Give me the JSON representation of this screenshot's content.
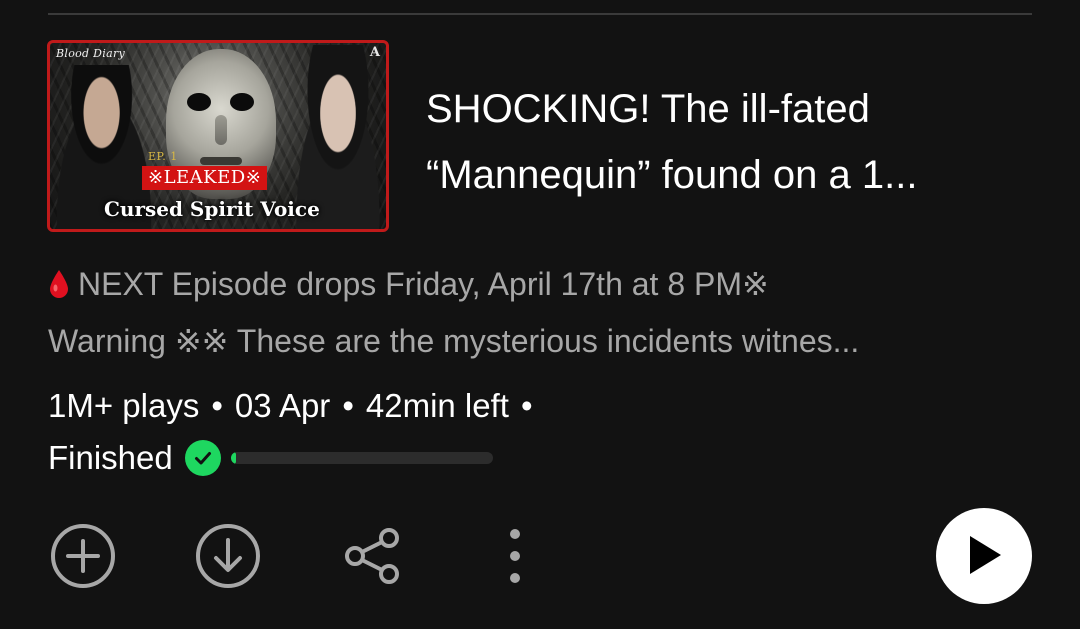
{
  "episode": {
    "thumbnail": {
      "logo_text": "Blood Diary",
      "corner_mark": "A",
      "episode_label": "EP. 1",
      "leaked_label": "※LEAKED※",
      "subtitle": "Cursed Spirit Voice"
    },
    "title_line1": "SHOCKING! The ill-fated",
    "title_line2": "“Mannequin” found on a 1...",
    "description_line1": "NEXT Episode drops Friday, April 17th at 8 PM※",
    "description_line2": "Warning ※※ These are the mysterious incidents witnes...",
    "description_icon": "blood-drop-icon",
    "plays": "1M+ plays",
    "date": "03 Apr",
    "time_left": "42min left",
    "separator": "•",
    "status": "Finished",
    "progress_fraction": 0.02
  },
  "actions": {
    "add": "add-circle-icon",
    "download": "download-circle-icon",
    "share": "share-icon",
    "more": "more-vertical-icon",
    "play": "play-icon"
  },
  "colors": {
    "background": "#121212",
    "accent_green": "#1ed760",
    "secondary_text": "#a7a7a7",
    "thumbnail_border": "#c01a1a"
  }
}
